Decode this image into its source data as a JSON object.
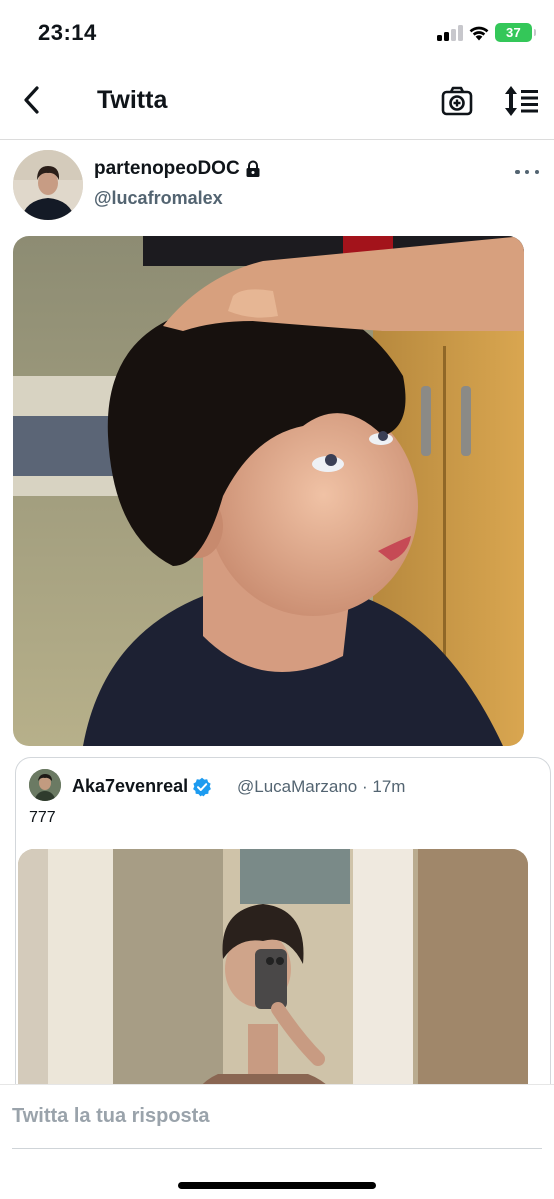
{
  "status_bar": {
    "time": "23:14",
    "battery": "37",
    "icons": [
      "signal-icon",
      "wifi-icon",
      "battery-icon"
    ]
  },
  "header": {
    "title": "Twitta",
    "icons": [
      "back-arrow-icon",
      "camera-plus-icon",
      "sort-icon"
    ]
  },
  "tweet": {
    "display_name": "partenopeoDOC",
    "handle": "@lucafromalex",
    "icons": [
      "lock-icon",
      "more-dots-icon"
    ]
  },
  "quoted_tweet": {
    "display_name": "Aka7evenreal",
    "meta": "@LucaMarzano · 17m",
    "text": "777",
    "icons": [
      "verified-badge-icon"
    ]
  },
  "reply": {
    "placeholder": "Twitta la tua risposta"
  },
  "colors": {
    "accent": "#1d9bf0",
    "muted_text": "#536471",
    "battery": "#34c759"
  }
}
